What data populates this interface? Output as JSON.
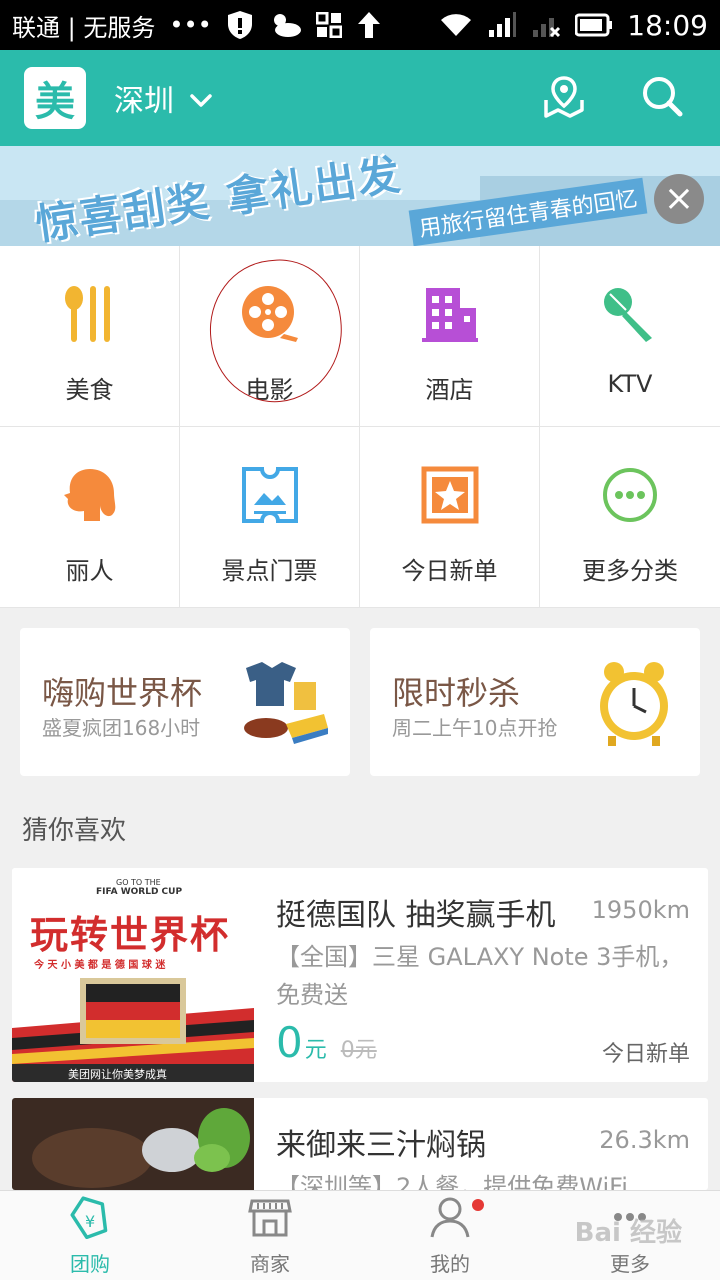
{
  "statusbar": {
    "carrier": "联通 | 无服务",
    "dots": "•••",
    "time": "18:09"
  },
  "header": {
    "logo": "美",
    "city": "深圳"
  },
  "banner": {
    "headline": "惊喜刮奖 拿礼出发",
    "subline": "用旅行留住青春的回忆",
    "close": "×"
  },
  "categories": [
    {
      "label": "美食",
      "icon": "fork-knife-icon",
      "color": "#f2b531"
    },
    {
      "label": "电影",
      "icon": "film-reel-icon",
      "color": "#f58a3c"
    },
    {
      "label": "酒店",
      "icon": "hotel-building-icon",
      "color": "#b74fd6"
    },
    {
      "label": "KTV",
      "icon": "microphone-icon",
      "color": "#3fbf88"
    },
    {
      "label": "丽人",
      "icon": "woman-head-icon",
      "color": "#f58a3c"
    },
    {
      "label": "景点门票",
      "icon": "ticket-icon",
      "color": "#42a8e6"
    },
    {
      "label": "今日新单",
      "icon": "star-box-icon",
      "color": "#f58a3c"
    },
    {
      "label": "更多分类",
      "icon": "more-dots-icon",
      "color": "#6cc45d"
    }
  ],
  "promos": [
    {
      "title": "嗨购世界杯",
      "subtitle": "盛夏疯团168小时"
    },
    {
      "title": "限时秒杀",
      "subtitle": "周二上午10点开抢"
    }
  ],
  "section_title": "猜你喜欢",
  "deals": [
    {
      "title": "挺德国队 抽奖赢手机",
      "distance": "1950km",
      "desc": "【全国】三星 GALAXY Note 3手机，免费送",
      "price": "0",
      "unit": "元",
      "orig": "0元",
      "tag": "今日新单",
      "img": {
        "top_small": "GO TO THE",
        "cup": "FIFA WORLD CUP",
        "big": "玩转世界杯",
        "sub": "今 天 小 美 都 是 德 国 球 迷",
        "bottom": "美团网让你美梦成真"
      }
    },
    {
      "title": "来御来三汁焖锅",
      "distance": "26.3km",
      "desc": "【深圳等】2人餐，提供免费WiFi"
    }
  ],
  "tabs": [
    {
      "label": "团购",
      "icon": "tag-icon"
    },
    {
      "label": "商家",
      "icon": "shop-icon"
    },
    {
      "label": "我的",
      "icon": "user-icon"
    },
    {
      "label": "更多",
      "icon": "more-icon"
    }
  ],
  "watermark": "Bai 经验"
}
